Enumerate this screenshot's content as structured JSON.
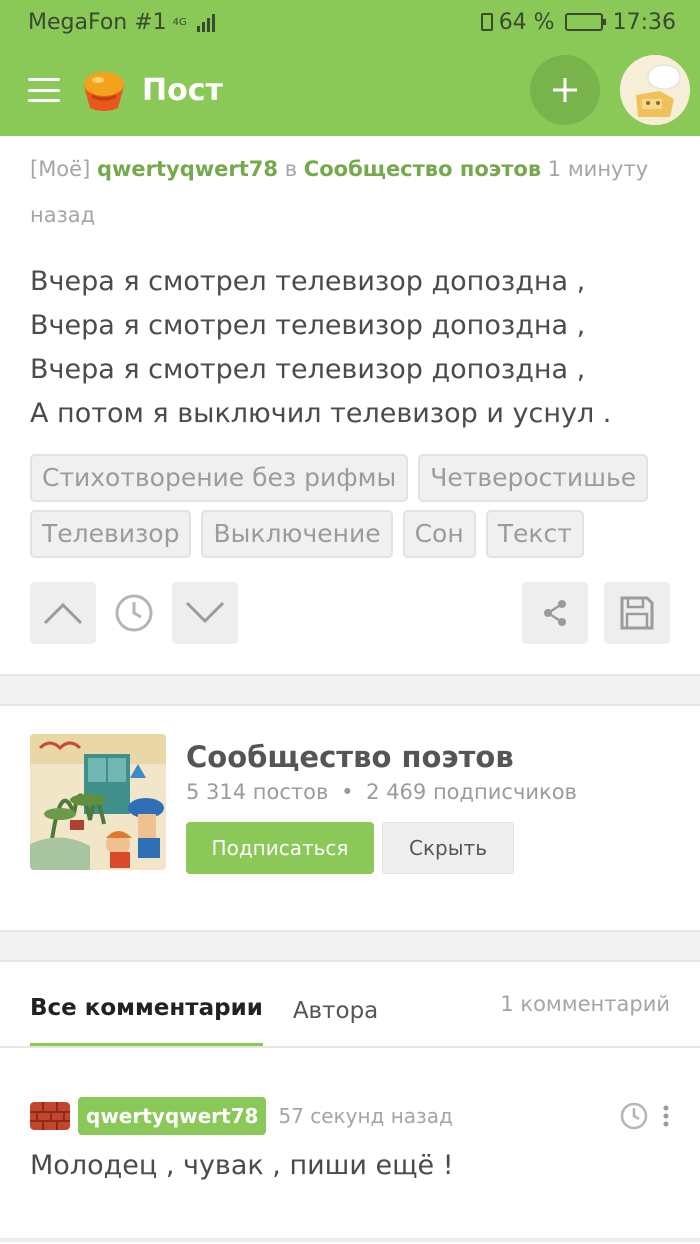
{
  "statusbar": {
    "carrier": "MegaFon #1",
    "network": "4G",
    "battery_percent": "64 %",
    "battery_level": 0.64,
    "time": "17:36"
  },
  "toolbar": {
    "title": "Пост",
    "icons": [
      "menu-icon",
      "pikabu-logo",
      "plus-icon",
      "user-avatar"
    ]
  },
  "post": {
    "prefix": "[Моё]",
    "author": "qwertyqwert78",
    "in_word": "в",
    "community": "Сообщество поэтов",
    "time": "1 минуту назад",
    "lines": [
      "Вчера я смотрел телевизор допоздна ,",
      "Вчера я смотрел телевизор допоздна ,",
      "Вчера я смотрел телевизор допоздна ,",
      "А потом я выключил телевизор и уснул ."
    ],
    "tags": [
      "Стихотворение без рифмы",
      "Четверостишье",
      "Телевизор",
      "Выключение",
      "Сон",
      "Текст"
    ]
  },
  "community_card": {
    "name": "Сообщество поэтов",
    "posts": "5 314 постов",
    "separator": "•",
    "subscribers": "2 469 подписчиков",
    "subscribe_label": "Подписаться",
    "hide_label": "Скрыть"
  },
  "comments_tabs": {
    "all": "Все комментарии",
    "author": "Автора",
    "count": "1 комментарий"
  },
  "comment": {
    "author": "qwertyqwert78",
    "time": "57 секунд назад",
    "text": "Молодец , чувак , пиши ещё !"
  },
  "colors": {
    "brand_green": "#8ac858",
    "dark_green": "#79b34c",
    "link_green": "#76a94b"
  }
}
